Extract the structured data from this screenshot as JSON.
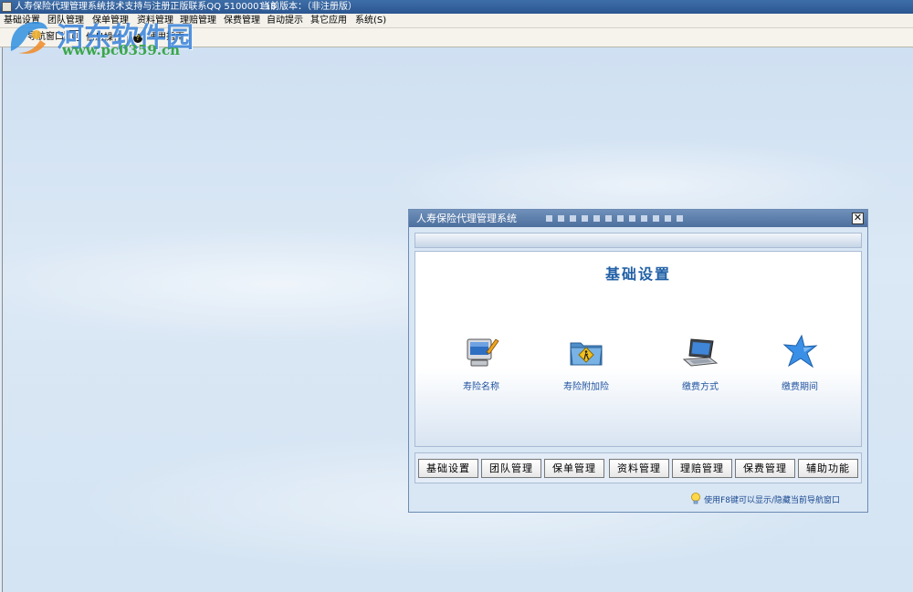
{
  "window": {
    "title": "人寿保险代理管理系统",
    "support_text": "-- 技术支持与注册正版联系QQ 510000118",
    "version_label": "当前版本：（非注册版）"
  },
  "menu": [
    {
      "label": "基础设置"
    },
    {
      "label": "团队管理"
    },
    {
      "label": "保单管理"
    },
    {
      "label": "资料管理"
    },
    {
      "label": "理赔管理"
    },
    {
      "label": "保费管理"
    },
    {
      "label": "自动提示"
    },
    {
      "label": "其它应用"
    },
    {
      "label": "系统(S)"
    }
  ],
  "toolbar": {
    "nav_label": "导航窗口",
    "info_label": "信息操作",
    "help_label": "使用指南"
  },
  "watermark": {
    "text": "河东软件园",
    "url": "www.pc0359.cn"
  },
  "dialog": {
    "title": "人寿保险代理管理系统",
    "close_glyph": "✕",
    "panel_title": "基础设置",
    "tiles": [
      {
        "label": "寿险名称",
        "icon": "computer-edit-icon"
      },
      {
        "label": "寿险附加险",
        "icon": "folder-person-icon"
      },
      {
        "label": "缴费方式",
        "icon": "laptop-icon"
      },
      {
        "label": "缴费期间",
        "icon": "star-icon"
      }
    ],
    "nav_buttons": [
      "基础设置",
      "团队管理",
      "保单管理",
      "资料管理",
      "理赔管理",
      "保费管理",
      "辅助功能"
    ],
    "tip": "使用F8键可以显示/隐藏当前导航窗口"
  },
  "colors": {
    "accent": "#2160a6",
    "titlebar": "#3e6ea8",
    "desktop": "#d4e4f3"
  }
}
